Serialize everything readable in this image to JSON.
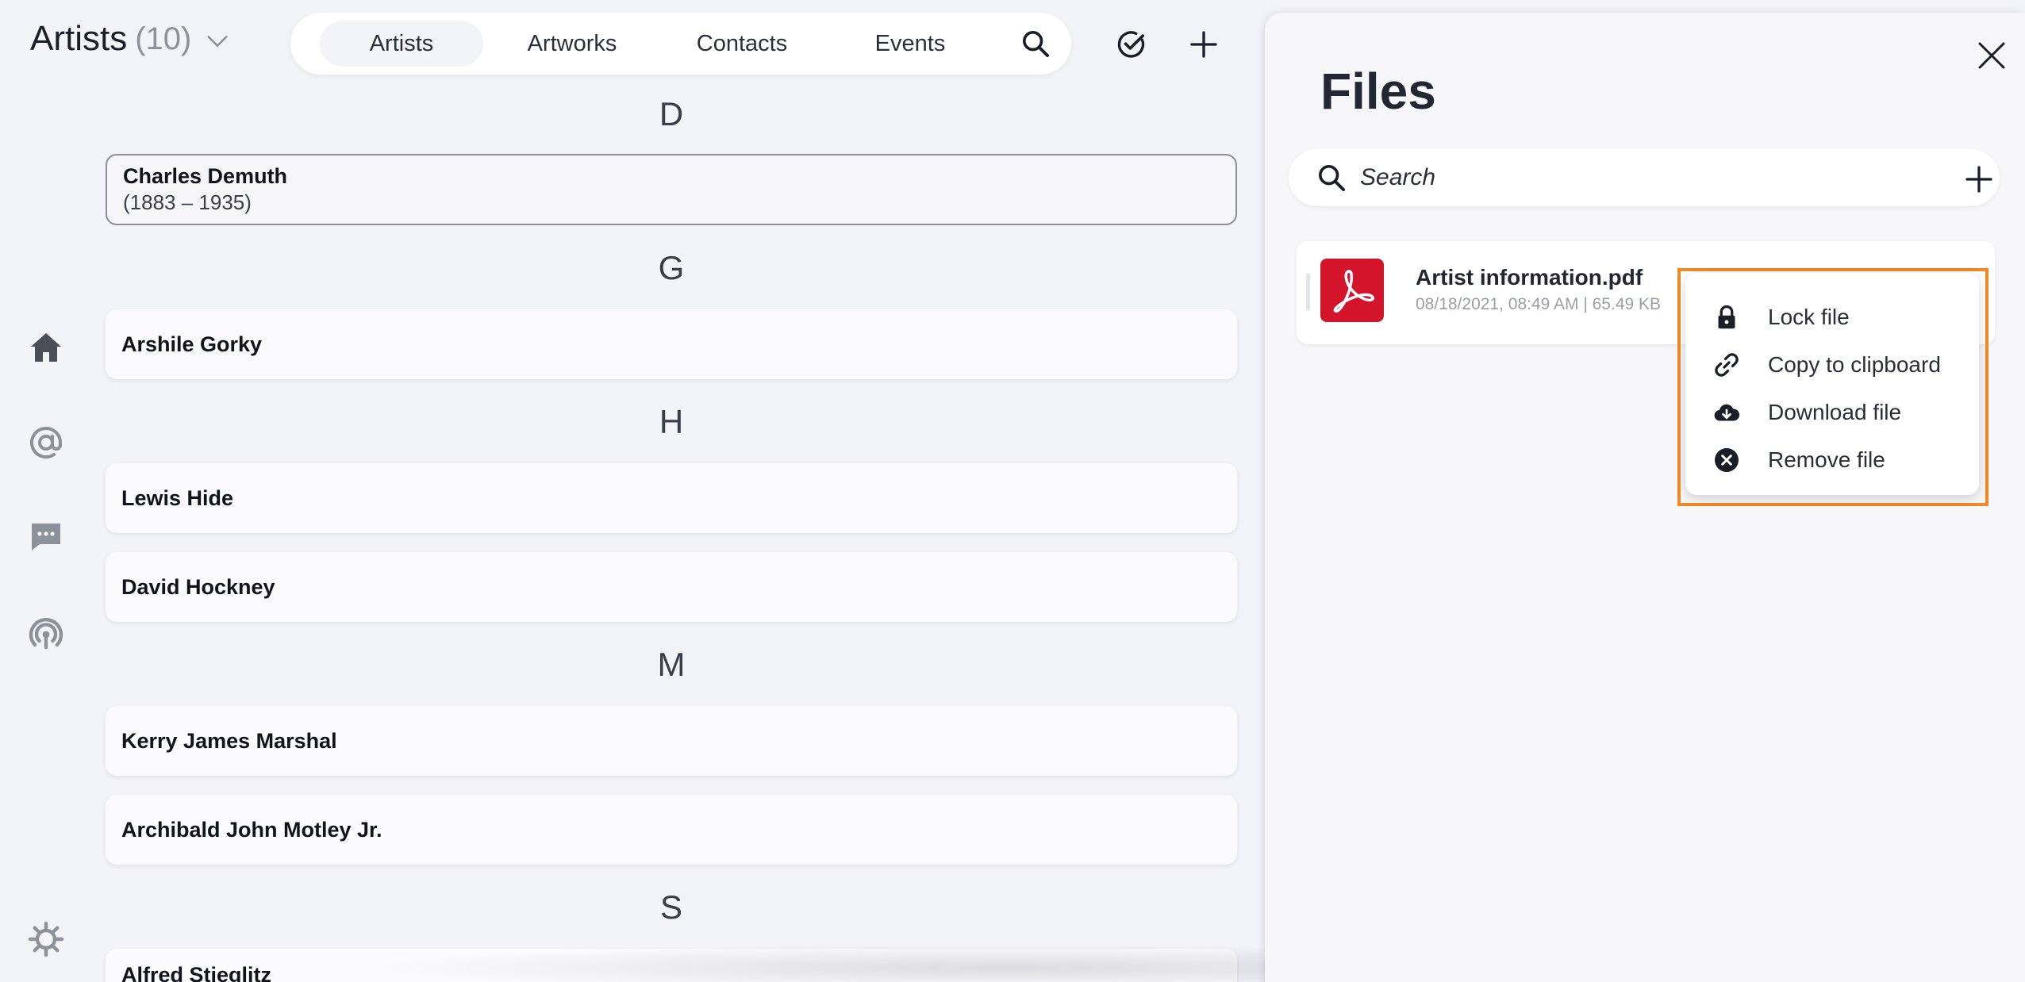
{
  "header": {
    "title": "Artists",
    "count": "(10)",
    "tabs": [
      {
        "label": "Artists",
        "active": true
      },
      {
        "label": "Artworks",
        "active": false
      },
      {
        "label": "Contacts",
        "active": false
      },
      {
        "label": "Events",
        "active": false
      }
    ]
  },
  "artists": {
    "groups": [
      {
        "letter": "D",
        "items": [
          {
            "name": "Charles Demuth",
            "years": "(1883 – 1935)",
            "selected": true
          }
        ]
      },
      {
        "letter": "G",
        "items": [
          {
            "name": "Arshile Gorky"
          }
        ]
      },
      {
        "letter": "H",
        "items": [
          {
            "name": "Lewis Hide"
          },
          {
            "name": "David Hockney"
          }
        ]
      },
      {
        "letter": "M",
        "items": [
          {
            "name": "Kerry James Marshal"
          },
          {
            "name": "Archibald John Motley Jr."
          }
        ]
      },
      {
        "letter": "S",
        "items": [
          {
            "name": "Alfred Stieglitz"
          }
        ]
      }
    ]
  },
  "files_panel": {
    "title": "Files",
    "search_placeholder": "Search",
    "file": {
      "name": "Artist information.pdf",
      "meta": "08/18/2021, 08:49 AM | 65.49 KB"
    },
    "context_menu": [
      {
        "label": "Lock file",
        "icon": "lock-icon"
      },
      {
        "label": "Copy to clipboard",
        "icon": "link-icon"
      },
      {
        "label": "Download file",
        "icon": "cloud-download-icon"
      },
      {
        "label": "Remove file",
        "icon": "remove-circle-icon"
      }
    ]
  },
  "colors": {
    "background": "#f3f4f8",
    "pdf_red": "#d3142a",
    "highlight_orange": "#f08a24",
    "text_dark": "#1a1e29"
  }
}
